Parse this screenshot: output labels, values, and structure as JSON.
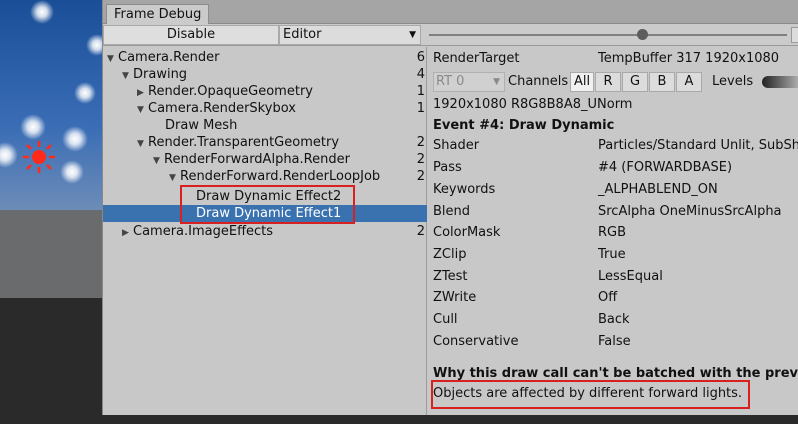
{
  "window": {
    "tab_title": "Frame Debug"
  },
  "toolbar": {
    "disable_label": "Disable",
    "editor_label": "Editor"
  },
  "tree": {
    "rows": [
      {
        "label": "Camera.Render",
        "count": "6",
        "expanded": true
      },
      {
        "label": "Drawing",
        "count": "4",
        "expanded": true
      },
      {
        "label": "Render.OpaqueGeometry",
        "count": "1",
        "expanded": false
      },
      {
        "label": "Camera.RenderSkybox",
        "count": "1",
        "expanded": true
      },
      {
        "label": "Draw Mesh",
        "count": ""
      },
      {
        "label": "Render.TransparentGeometry",
        "count": "2",
        "expanded": true
      },
      {
        "label": "RenderForwardAlpha.Render",
        "count": "2",
        "expanded": true
      },
      {
        "label": "RenderForward.RenderLoopJob",
        "count": "2",
        "expanded": true
      },
      {
        "label": "Draw Dynamic Effect2",
        "count": ""
      },
      {
        "label": "Draw Dynamic Effect1",
        "count": "",
        "selected": true
      },
      {
        "label": "Camera.ImageEffects",
        "count": "2",
        "expanded": false
      }
    ]
  },
  "details": {
    "render_target_label": "RenderTarget",
    "render_target_value": "TempBuffer 317 1920x1080",
    "rt_select": "RT 0",
    "channels_label": "Channels",
    "channels": [
      "All",
      "R",
      "G",
      "B",
      "A"
    ],
    "levels_label": "Levels",
    "format": "1920x1080 R8G8B8A8_UNorm",
    "event_title": "Event #4: Draw Dynamic",
    "properties": [
      {
        "key": "Shader",
        "value": "Particles/Standard Unlit, SubSha"
      },
      {
        "key": "Pass",
        "value": "#4 (FORWARDBASE)"
      },
      {
        "key": "Keywords",
        "value": "_ALPHABLEND_ON"
      },
      {
        "key": "Blend",
        "value": "SrcAlpha OneMinusSrcAlpha"
      },
      {
        "key": "ColorMask",
        "value": "RGB"
      },
      {
        "key": "ZClip",
        "value": "True"
      },
      {
        "key": "ZTest",
        "value": "LessEqual"
      },
      {
        "key": "ZWrite",
        "value": "Off"
      },
      {
        "key": "Cull",
        "value": "Back"
      },
      {
        "key": "Conservative",
        "value": "False"
      }
    ],
    "batch_heading": "Why this draw call can't be batched with the previous on",
    "batch_reason": "Objects are affected by different forward lights."
  },
  "colors": {
    "selection": "#3a72b0",
    "highlight_box": "#d92020",
    "panel_bg": "#c8c8c8"
  }
}
